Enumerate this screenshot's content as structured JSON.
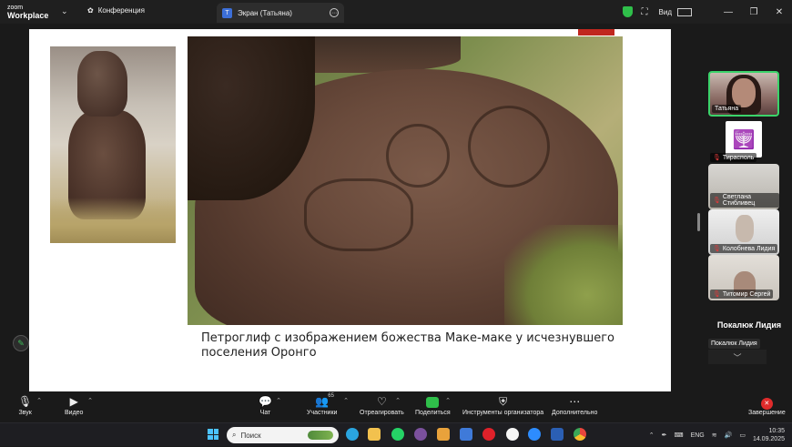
{
  "titlebar": {
    "logo_line1": "zoom",
    "logo_line2": "Workplace",
    "chevron": "⌄",
    "conference_label": "Конференция",
    "tab_badge": "T",
    "tab_label": "Экран (Татьяна)",
    "tab_menu": "⋯",
    "view_label": "Вид",
    "minimize": "—",
    "maximize": "❐",
    "close": "✕"
  },
  "slide": {
    "caption": "Петроглиф с изображением божества Маке-маке у исчезнувшего поселения Оронго"
  },
  "participants": {
    "tiles": [
      {
        "name": "Татьяна",
        "muted": false
      },
      {
        "name": "Тирасполь",
        "muted": true
      },
      {
        "name": "Светлана Стибливец",
        "muted": true
      },
      {
        "name": "Колобнева Лидия",
        "muted": true
      },
      {
        "name": "Титомир Сергей",
        "muted": true
      }
    ],
    "active_speaker": "Покалюк Лидия",
    "active_speaker_chip": "Покалюк Лидия",
    "more_chevron": "﹀"
  },
  "toolbar": {
    "audio_label": "Звук",
    "video_label": "Видео",
    "chat_label": "Чат",
    "participants_label": "Участники",
    "participants_count": "65",
    "react_label": "Отреагировать",
    "share_label": "Поделиться",
    "host_tools_label": "Инструменты организатора",
    "more_label": "Дополнительно",
    "end_label": "Завершение",
    "caret": "⌃"
  },
  "taskbar": {
    "search_placeholder": "Поиск",
    "lang": "ENG",
    "time": "10:35",
    "date": "14.09.2025",
    "tray_chevron": "⌃"
  },
  "colors": {
    "active_border": "#3bd36a",
    "end_red": "#e02b2b",
    "share_green": "#2fbf4a",
    "slide_red": "#c0271f"
  }
}
